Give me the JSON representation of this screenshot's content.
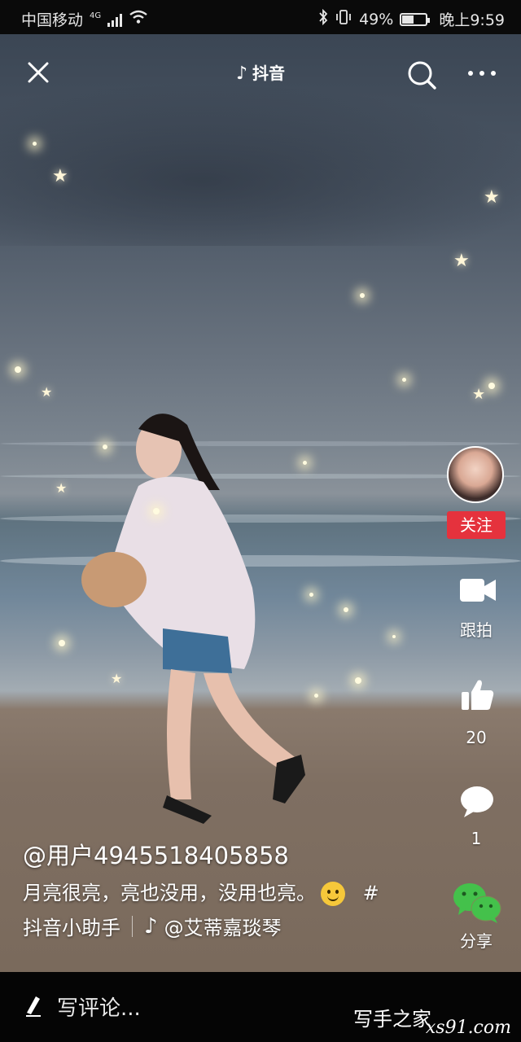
{
  "statusbar": {
    "carrier": "中国移动",
    "network": "4G",
    "battery_percent": "49%",
    "battery_level": 0.49,
    "time": "晚上9:59"
  },
  "topbar": {
    "title": "抖音",
    "icons": [
      "close-icon",
      "douyin-logo-icon",
      "search-icon",
      "more-icon"
    ]
  },
  "sidebar": {
    "follow_label": "关注",
    "duet_label": "跟拍",
    "like_count": "20",
    "comment_count": "1",
    "share_label": "分享"
  },
  "caption": {
    "username": "@用户4945518405858",
    "text": "月亮很亮，亮也没用，没用也亮。",
    "hashtag_mark": "#",
    "hashtag": "抖音小助手",
    "music": "@艾蒂嘉琰琴"
  },
  "bottombar": {
    "comment_placeholder": "写评论...",
    "watermark_top": "写手之家",
    "watermark_bottom": "xs91.com"
  },
  "colors": {
    "follow_red": "#e5323d",
    "background": "#000000"
  }
}
